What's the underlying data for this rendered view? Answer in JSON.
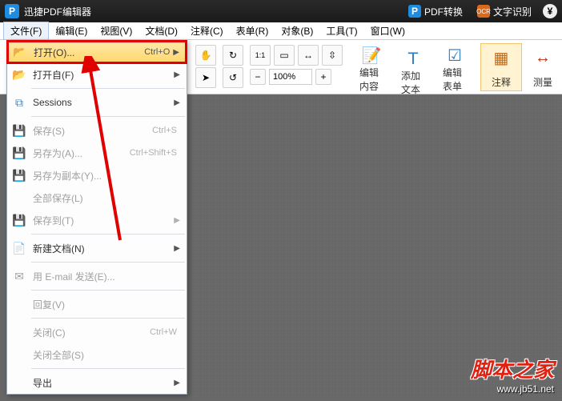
{
  "titlebar": {
    "logo": "P",
    "title": "迅捷PDF编辑器",
    "btn_convert": "PDF转换",
    "btn_ocr": "文字识别",
    "yen": "¥"
  },
  "menubar": [
    "文件(F)",
    "编辑(E)",
    "视图(V)",
    "文档(D)",
    "注释(C)",
    "表单(R)",
    "对象(B)",
    "工具(T)",
    "窗口(W)"
  ],
  "ribbon": {
    "zoom_value": "100%",
    "edit_content": "编辑内容",
    "add_text": "添加文本",
    "edit_form": "编辑表单",
    "annotate": "注释",
    "measure": "测量"
  },
  "menu": {
    "open": {
      "label": "打开(O)...",
      "shortcut": "Ctrl+O"
    },
    "open_from": {
      "label": "打开自(F)"
    },
    "sessions": {
      "label": "Sessions"
    },
    "save": {
      "label": "保存(S)",
      "shortcut": "Ctrl+S"
    },
    "save_as": {
      "label": "另存为(A)...",
      "shortcut": "Ctrl+Shift+S"
    },
    "save_copy": {
      "label": "另存为副本(Y)..."
    },
    "save_all": {
      "label": "全部保存(L)"
    },
    "save_to": {
      "label": "保存到(T)"
    },
    "new_doc": {
      "label": "新建文档(N)"
    },
    "email": {
      "label": "用 E-mail 发送(E)..."
    },
    "revert": {
      "label": "回复(V)"
    },
    "close": {
      "label": "关闭(C)",
      "shortcut": "Ctrl+W"
    },
    "close_all": {
      "label": "关闭全部(S)"
    },
    "export": {
      "label": "导出"
    }
  },
  "watermark": {
    "cn": "脚本之家",
    "url": "www.jb51.net"
  }
}
